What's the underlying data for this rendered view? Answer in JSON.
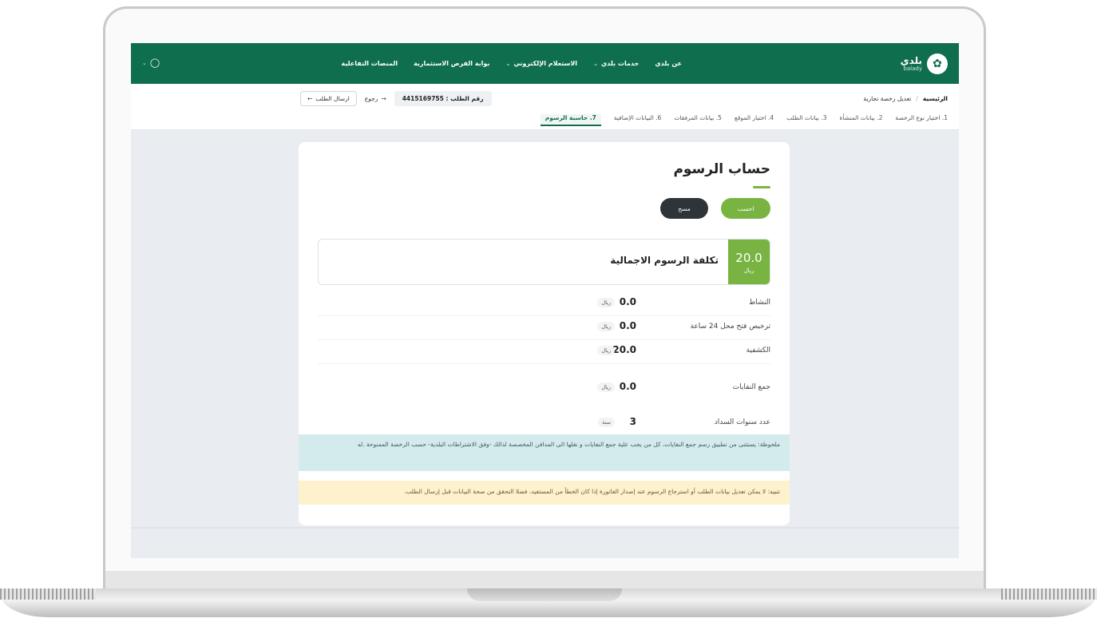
{
  "brand": {
    "name_ar": "بلدي",
    "name_en": "balady"
  },
  "nav": {
    "links": [
      {
        "label": "عن بلدي",
        "has_dropdown": false
      },
      {
        "label": "خدمات بلدي",
        "has_dropdown": true
      },
      {
        "label": "الاستعلام الإلكتروني",
        "has_dropdown": true
      },
      {
        "label": "بوابة الفرص الاستثمارية",
        "has_dropdown": false
      },
      {
        "label": "المنصات التفاعلية",
        "has_dropdown": false
      }
    ]
  },
  "breadcrumb": {
    "home": "الرئيسية",
    "current": "تعديل رخصة تجارية"
  },
  "request": {
    "number_text": "رقم الطلب : 4415169755",
    "back_label": "رجوع",
    "send_label": "ارسال الطلب"
  },
  "steps": [
    {
      "label": "1. اختيار نوع الرخصة",
      "active": false
    },
    {
      "label": "2. بيانات المنشأة",
      "active": false
    },
    {
      "label": "3. بيانات الطلب",
      "active": false
    },
    {
      "label": "4. اختيار الموقع",
      "active": false
    },
    {
      "label": "5. بيانات المرفقات",
      "active": false
    },
    {
      "label": "6. البيانات الإضافية",
      "active": false
    },
    {
      "label": "7. حاسبة الرسوم",
      "active": true
    }
  ],
  "calculator": {
    "title": "حساب الرسوم",
    "calc_button": "احسب",
    "clear_button": "مسح",
    "total": {
      "value": "20.0",
      "unit": "ريال",
      "label": "تكلفة الرسوم الاجمالية"
    },
    "fees": [
      {
        "label": "النشاط",
        "value": "0.0",
        "unit": "ريال"
      },
      {
        "label": "ترخيص فتح محل 24 ساعة",
        "value": "0.0",
        "unit": "ريال"
      },
      {
        "label": "الكشفية",
        "value": "20.0",
        "unit": "ريال"
      },
      {
        "label": "جمع النفايات",
        "value": "0.0",
        "unit": "ريال"
      },
      {
        "label": "عدد سنوات السداد",
        "value": "3",
        "unit": "سنة"
      }
    ],
    "note_info": "ملحوظة: يستثنى من تطبيق رسم جمع النفايات، كل من يجب علية جمع النفايات و نقلها الى المدافن المخصصة لذالك -وفق الاشتراطات البلدية- حسب الرخصة الممنوحة .له",
    "note_warning": "تنبيه: لا يمكن تعديل بيانات الطلب أو استرجاع الرسوم عند إصدار الفاتورة إذا كان الخطأ من المستفيد، فضلا التحقق من صحة البيانات قبل إرسال الطلب."
  },
  "colors": {
    "nav_bg": "#0f6e4e",
    "accent_green": "#79b443",
    "dark_button": "#2f3438",
    "info_bg": "#d4ebee",
    "warning_bg": "#fdf1ce"
  }
}
